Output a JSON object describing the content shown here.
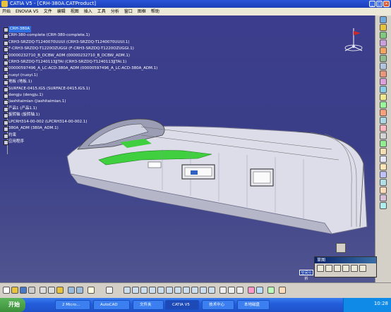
{
  "window": {
    "title": "CATIA V5 - [CRH-380A.CATProduct]"
  },
  "menu": [
    "开始",
    "ENOVIA V5",
    "文件",
    "编辑",
    "视图",
    "插入",
    "工具",
    "分析",
    "窗口",
    "图框",
    "帮助"
  ],
  "tree": {
    "root": "CRH-380A",
    "nodes": [
      "CRH-380-complete (CRH-380-complete.1)",
      "CRH3-SRZDQ-T1240070UUUI (CRH3-SRZDQ-T1240070UUUI.1)",
      "F-CRH3-SRZDQ-T1220OZUGGI (F-CRH3-SRZDQ-T1220OZUGGI.1)",
      "00000232710_B_DCBW_ADM (00000232710_B_DCBW_ADM.1)",
      "CRH3-SRZDQ-T1240113JJTAI (CRH3-SRZDQ-T1240113JJTAI.1)",
      "00000597496_A_LC-ACD-380A_ADM (00000597496_A_LC-ACD-380A_ADM.1)",
      "nuoyi (nuoyi.1)",
      "地板 (地板.1)",
      "SURFACE-0415.IGS (SURFACE-0415.IGS.1)",
      "dengju (dengju.1)",
      "jiashitaimian (jiashitaimian.1)",
      "产品1 (产品1.1)",
      "旋转轴 (旋转轴.1)",
      "LPCRH314-00-002 (LPCRH314-00-002.1)",
      "380A_ADM (380A_ADM.1)",
      "约束",
      "应用程序"
    ]
  },
  "palette": {
    "title": "草图"
  },
  "mini_label": "空间分析",
  "taskbar": {
    "start": "开始",
    "tasks": [
      "2 Micro...",
      "AutoCAD",
      "文件夹",
      "CATIA V5",
      "技术中心",
      "本地磁盘"
    ],
    "clock": "10:28"
  },
  "colors": {
    "viewport_bg": "#3a3d86",
    "hull_fill": "#d9dbe6",
    "hull_green": "#3fcf3f"
  }
}
